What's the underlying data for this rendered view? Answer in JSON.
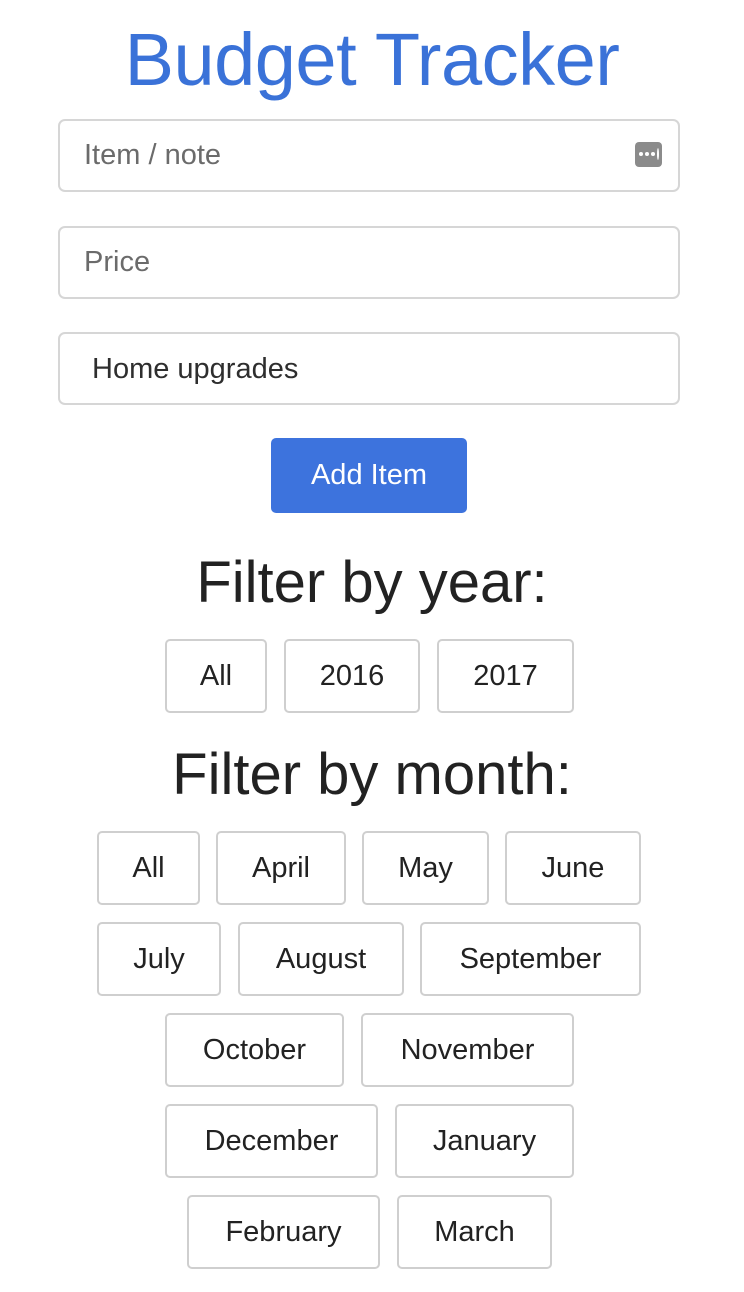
{
  "app": {
    "title": "Budget Tracker"
  },
  "form": {
    "item_placeholder": "Item / note",
    "item_value": "",
    "price_placeholder": "Price",
    "price_value": "",
    "category_selected": "Home upgrades",
    "add_button_label": "Add Item"
  },
  "filters": {
    "year_heading": "Filter by year:",
    "years": [
      "All",
      "2016",
      "2017"
    ],
    "month_heading": "Filter by month:",
    "months": [
      "All",
      "April",
      "May",
      "June",
      "July",
      "August",
      "September",
      "October",
      "November",
      "December",
      "January",
      "February",
      "March"
    ]
  },
  "icons": {
    "autofill": "password-autofill-icon"
  },
  "colors": {
    "accent": "#3a72d8",
    "button": "#3d73dd",
    "border": "#d6d6d6"
  }
}
